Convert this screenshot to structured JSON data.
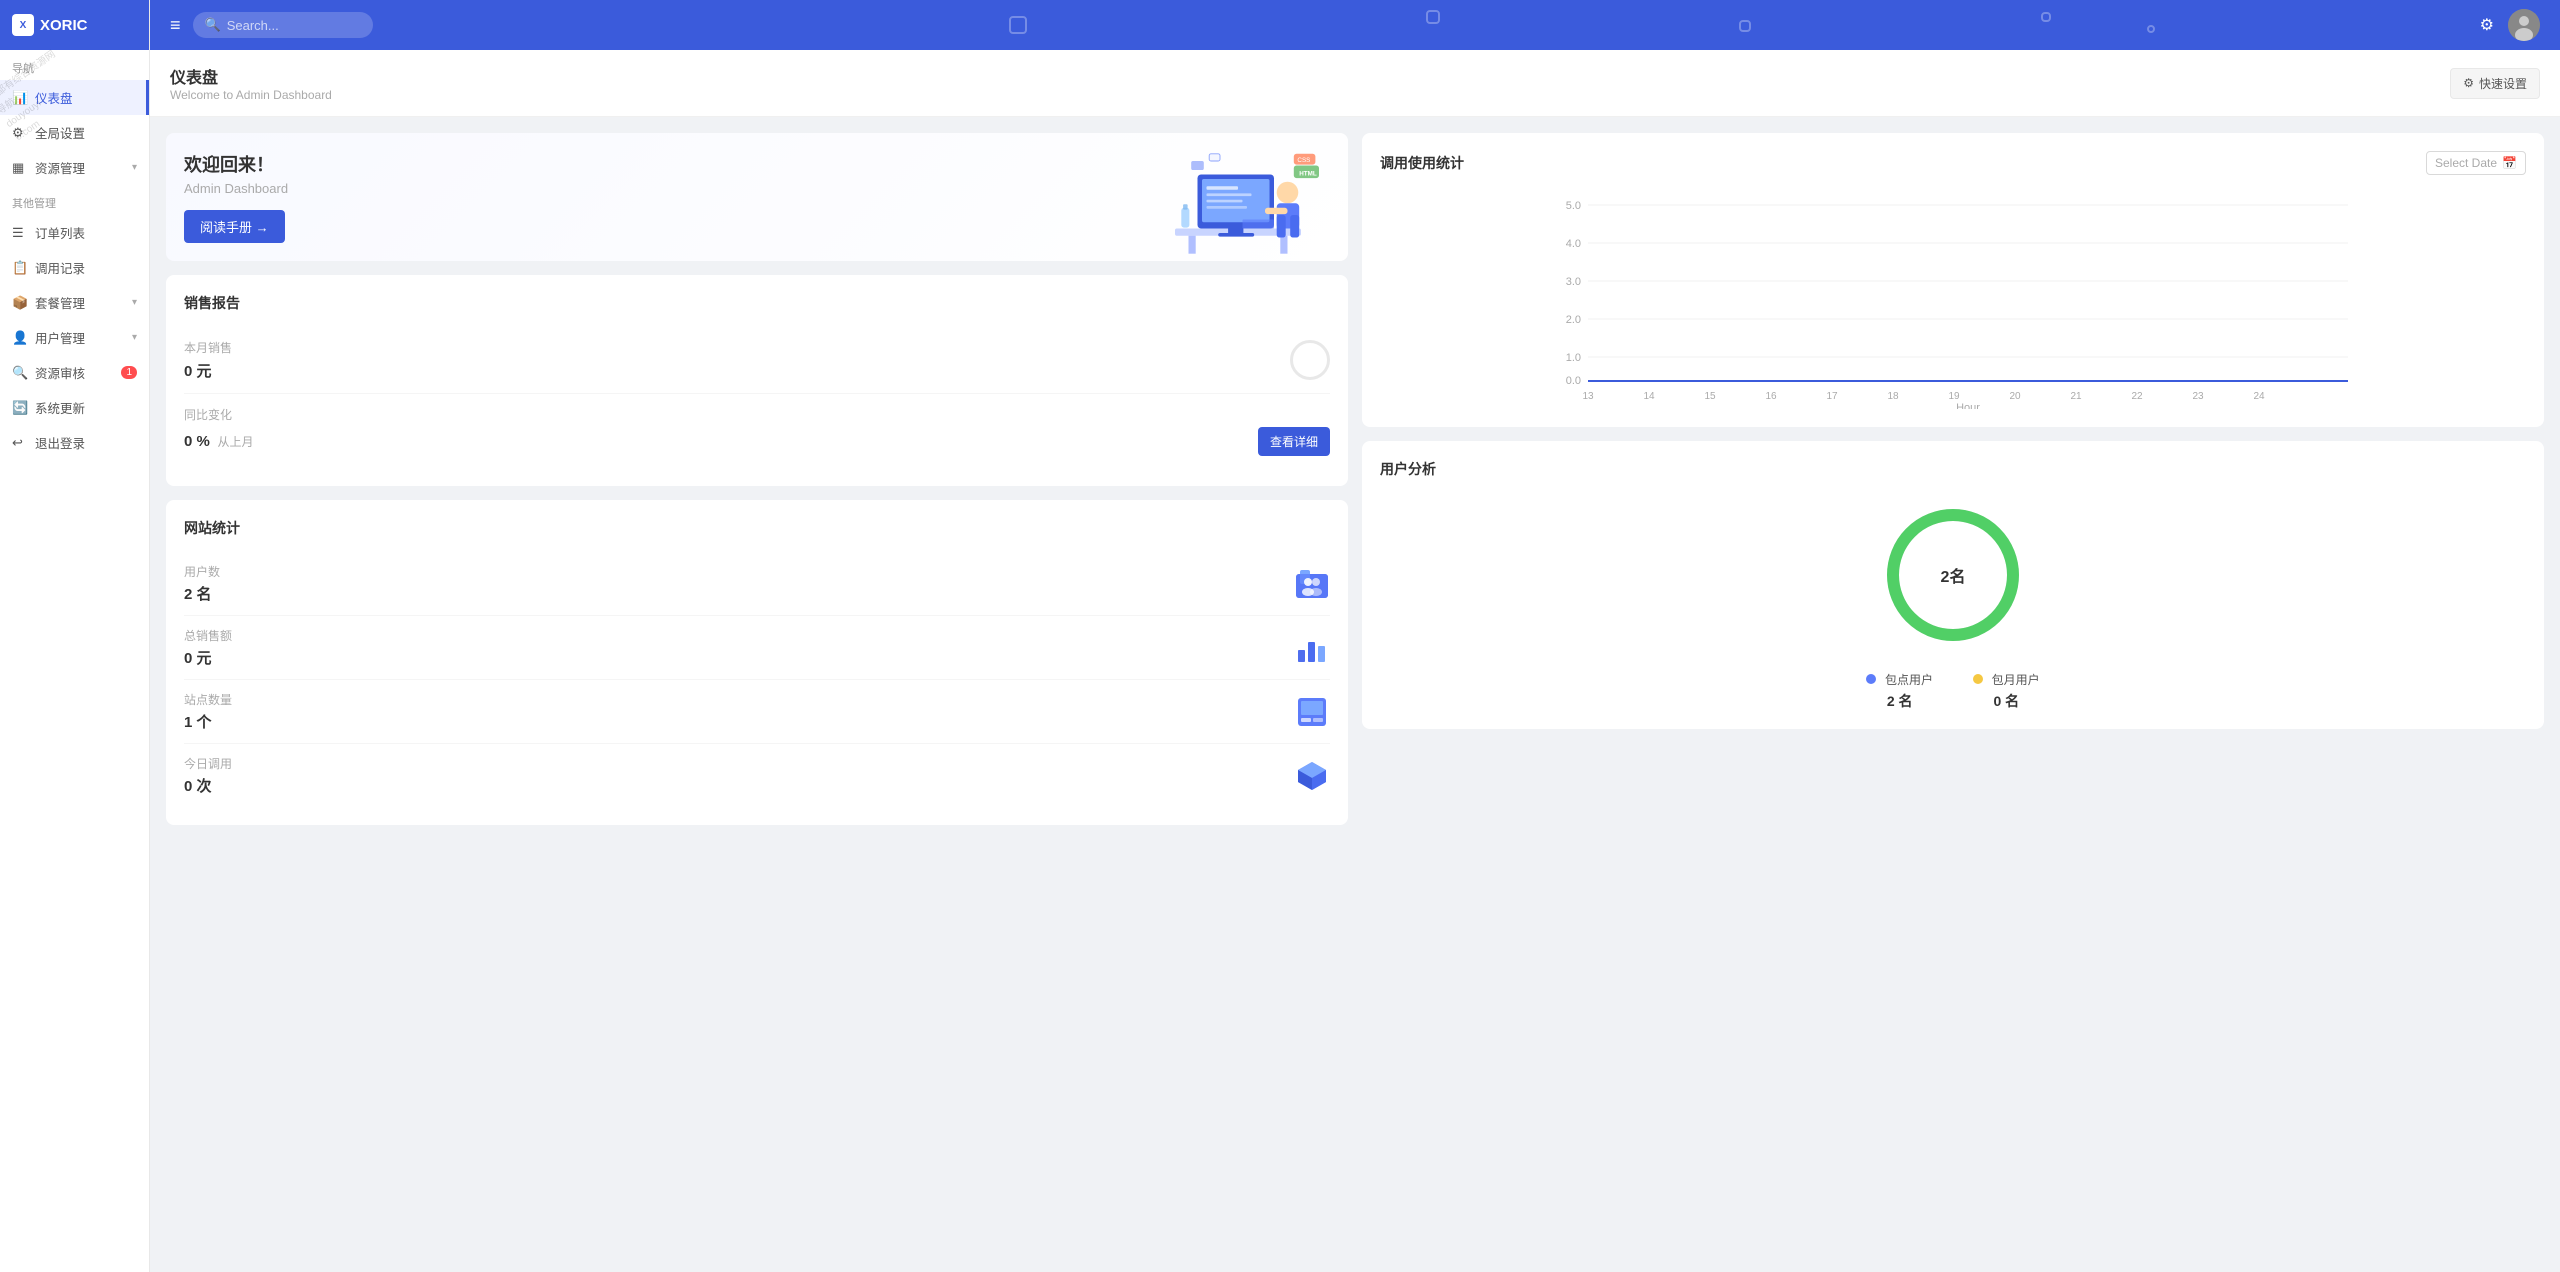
{
  "app": {
    "name": "XORIC",
    "logo_text": "X"
  },
  "sidebar": {
    "nav_label": "导航",
    "other_label": "其他管理",
    "items": [
      {
        "id": "dashboard",
        "label": "仪表盘",
        "icon": "chart-icon",
        "active": true
      },
      {
        "id": "global-settings",
        "label": "全局设置",
        "icon": "settings-icon",
        "active": false
      },
      {
        "id": "resource-management",
        "label": "资源管理",
        "icon": "grid-icon",
        "active": false,
        "has_arrow": true
      },
      {
        "id": "order-list",
        "label": "订单列表",
        "icon": "list-icon",
        "active": false
      },
      {
        "id": "call-records",
        "label": "调用记录",
        "icon": "record-icon",
        "active": false
      },
      {
        "id": "package-management",
        "label": "套餐管理",
        "icon": "package-icon",
        "active": false,
        "has_arrow": true
      },
      {
        "id": "user-management",
        "label": "用户管理",
        "icon": "user-icon",
        "active": false,
        "has_arrow": true
      },
      {
        "id": "resource-audit",
        "label": "资源审核",
        "icon": "audit-icon",
        "active": false,
        "badge": "1"
      },
      {
        "id": "system-update",
        "label": "系统更新",
        "icon": "update-icon",
        "active": false
      },
      {
        "id": "logout",
        "label": "退出登录",
        "icon": "logout-icon",
        "active": false
      }
    ]
  },
  "header": {
    "search_placeholder": "Search...",
    "menu_toggle_icon": "≡",
    "filter_icon": "⚙",
    "quick_settings_label": "快速设置"
  },
  "page": {
    "title": "仪表盘",
    "subtitle": "Welcome to Admin Dashboard"
  },
  "welcome": {
    "greeting": "欢迎回来！",
    "subtitle": "Admin Dashboard",
    "button_label": "阅读手册 →"
  },
  "sales_report": {
    "title": "销售报告",
    "monthly_label": "本月销售",
    "monthly_value": "0 元",
    "change_label": "同比变化",
    "change_value": "0 %",
    "change_suffix": "从上月",
    "details_btn": "查看详细"
  },
  "site_stats": {
    "title": "网站统计",
    "items": [
      {
        "label": "用户数",
        "value": "2 名",
        "icon": "users-3d-icon"
      },
      {
        "label": "总销售额",
        "value": "0 元",
        "icon": "bar-chart-3d-icon"
      },
      {
        "label": "站点数量",
        "value": "1 个",
        "icon": "site-3d-icon"
      },
      {
        "label": "今日调用",
        "value": "0 次",
        "icon": "cube-3d-icon"
      }
    ]
  },
  "chart": {
    "title": "调用使用统计",
    "date_picker_label": "Select Date",
    "x_label": "Hour",
    "y_values": [
      "5.0",
      "4.0",
      "3.0",
      "2.0",
      "1.0",
      "0.0"
    ],
    "x_values": [
      "13",
      "14",
      "15",
      "16",
      "17",
      "18",
      "19",
      "20",
      "21",
      "22",
      "23",
      "24"
    ]
  },
  "user_analysis": {
    "title": "用户分析",
    "center_label": "2名",
    "legend": [
      {
        "label": "包点用户",
        "value": "2 名",
        "color": "#5c7cfa"
      },
      {
        "label": "包月用户",
        "value": "0 名",
        "color": "#f5c842"
      }
    ]
  }
}
